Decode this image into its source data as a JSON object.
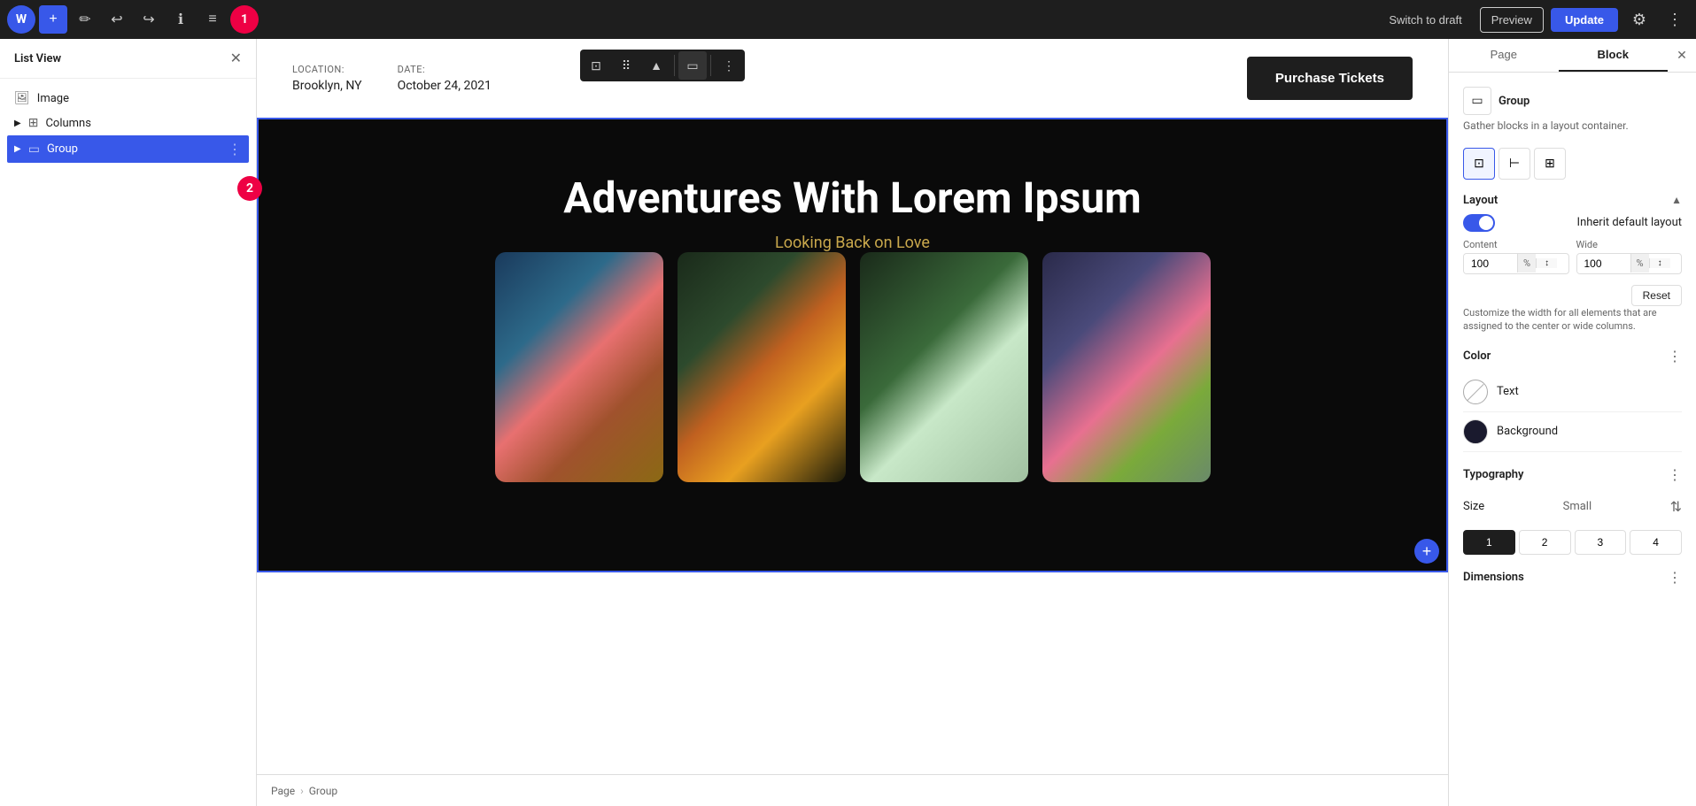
{
  "toolbar": {
    "add_label": "+",
    "undo_label": "↩",
    "redo_label": "↪",
    "info_label": "ℹ",
    "list_label": "≡",
    "notification_count": "1",
    "switch_draft_label": "Switch to draft",
    "preview_label": "Preview",
    "update_label": "Update"
  },
  "list_view": {
    "title": "List View",
    "items": [
      {
        "id": "image",
        "label": "Image",
        "icon": "🖼",
        "indent": false
      },
      {
        "id": "columns",
        "label": "Columns",
        "icon": "⊞",
        "indent": false,
        "has_chevron": true
      },
      {
        "id": "group",
        "label": "Group",
        "icon": "▭",
        "indent": false,
        "active": true
      }
    ]
  },
  "right_panel": {
    "tab_page": "Page",
    "tab_block": "Block",
    "active_tab": "Block",
    "close_label": "✕",
    "block_info": {
      "title": "Group",
      "description": "Gather blocks in a layout container."
    },
    "layout": {
      "title": "Layout",
      "toggle_label": "Inherit default layout",
      "toggle_on": true,
      "content_label": "Content",
      "content_value": "100",
      "content_unit": "%",
      "wide_label": "Wide",
      "wide_value": "100",
      "wide_unit": "%",
      "reset_label": "Reset",
      "help_text": "Customize the width for all elements that are assigned to the center or wide columns."
    },
    "color": {
      "title": "Color",
      "text_label": "Text",
      "background_label": "Background",
      "background_dark": true
    },
    "typography": {
      "title": "Typography",
      "size_label": "Size",
      "size_value": "Small"
    },
    "page_sizes": [
      "1",
      "2",
      "3",
      "4"
    ],
    "active_size": "1",
    "dimensions": {
      "title": "Dimensions"
    }
  },
  "canvas": {
    "event": {
      "location_label": "Location:",
      "location_value": "Brooklyn, NY",
      "date_label": "Date:",
      "date_value": "October 24, 2021",
      "purchase_btn": "Purchase Tickets"
    },
    "hero": {
      "title": "Adventures With Lorem Ipsum",
      "subtitle": "Looking Back on Love"
    },
    "photos": [
      {
        "id": "photo-1",
        "alt": "Flower on rocks"
      },
      {
        "id": "photo-2",
        "alt": "Orange flowers dark"
      },
      {
        "id": "photo-3",
        "alt": "Water splash green"
      },
      {
        "id": "photo-4",
        "alt": "Pink flower on pebbles"
      }
    ]
  },
  "breadcrumb": {
    "page_label": "Page",
    "separator": "›",
    "group_label": "Group"
  }
}
